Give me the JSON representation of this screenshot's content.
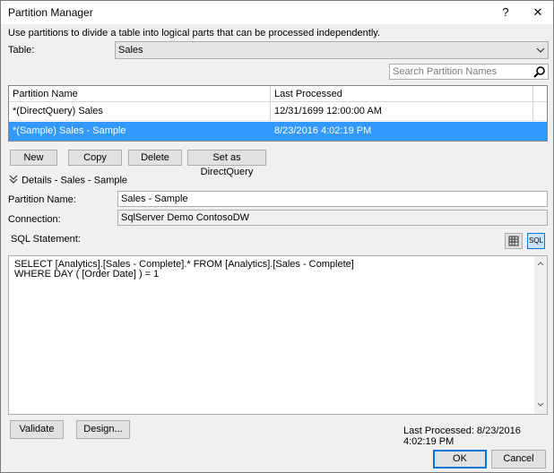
{
  "window": {
    "title": "Partition Manager",
    "help_glyph": "?",
    "close_glyph": "✕"
  },
  "description": "Use partitions to divide a table into logical parts that can be processed independently.",
  "table": {
    "label": "Table:",
    "value": "Sales"
  },
  "search": {
    "placeholder": "Search Partition Names"
  },
  "grid": {
    "columns": [
      "Partition Name",
      "Last Processed"
    ],
    "rows": [
      {
        "name": "*(DirectQuery) Sales",
        "last_processed": "12/31/1699 12:00:00 AM",
        "selected": false
      },
      {
        "name": "*(Sample) Sales - Sample",
        "last_processed": "8/23/2016 4:02:19 PM",
        "selected": true
      }
    ]
  },
  "actions": {
    "new": "New",
    "copy": "Copy",
    "delete": "Delete",
    "directquery": "Set as DirectQuery"
  },
  "details": {
    "header": "Details - Sales - Sample",
    "partition_name_label": "Partition Name:",
    "partition_name_value": "Sales - Sample",
    "connection_label": "Connection:",
    "connection_value": "SqlServer Demo ContosoDW",
    "sql_label": "SQL Statement:",
    "sql_mode_label": "SQL",
    "sql_lines": [
      "SELECT [Analytics].[Sales - Complete].* FROM [Analytics].[Sales - Complete]",
      "WHERE DAY ( [Order Date] ) = 1"
    ]
  },
  "footer": {
    "validate": "Validate",
    "design": "Design...",
    "last_processed": "Last Processed: 8/23/2016 4:02:19 PM",
    "ok": "OK",
    "cancel": "Cancel"
  }
}
